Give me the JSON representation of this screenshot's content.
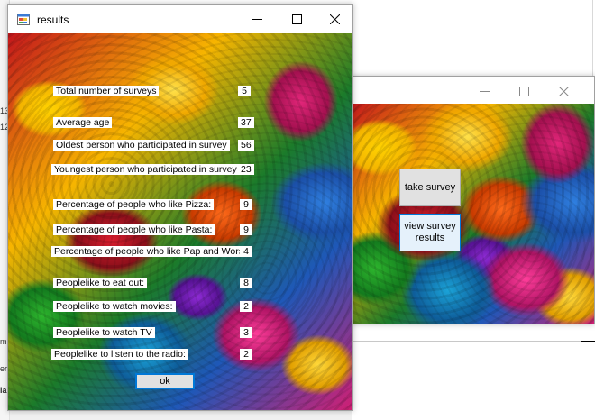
{
  "results_window": {
    "title": "results",
    "rows": [
      {
        "label": "Total number of surveys",
        "value": "5"
      },
      {
        "label": "Average age",
        "value": "37"
      },
      {
        "label": "Oldest person who participated in survey",
        "value": "56"
      },
      {
        "label": "Youngest person who participated in survey",
        "value": "23"
      },
      {
        "label": "Percentage of people who like Pizza:",
        "value": "9"
      },
      {
        "label": "Percentage of people who like Pasta:",
        "value": "9"
      },
      {
        "label": "Percentage of people who like Pap and Wors:",
        "value": "4"
      },
      {
        "label": "Peoplelike to eat out:",
        "value": "8"
      },
      {
        "label": "Peoplelike to watch movies:",
        "value": "2"
      },
      {
        "label": "Peoplelike to watch TV",
        "value": "3"
      },
      {
        "label": "Peoplelike to listen to the radio:",
        "value": "2"
      }
    ],
    "ok_label": "ok"
  },
  "main_window": {
    "take_survey_label": "take survey",
    "view_results_label": "view survey results"
  },
  "icons": {
    "app": "app-icon",
    "minimize": "minimize-icon",
    "maximize": "maximize-icon",
    "close": "close-icon"
  },
  "colors": {
    "focus_border": "#0078d7",
    "button_face": "#e1e1e1"
  }
}
